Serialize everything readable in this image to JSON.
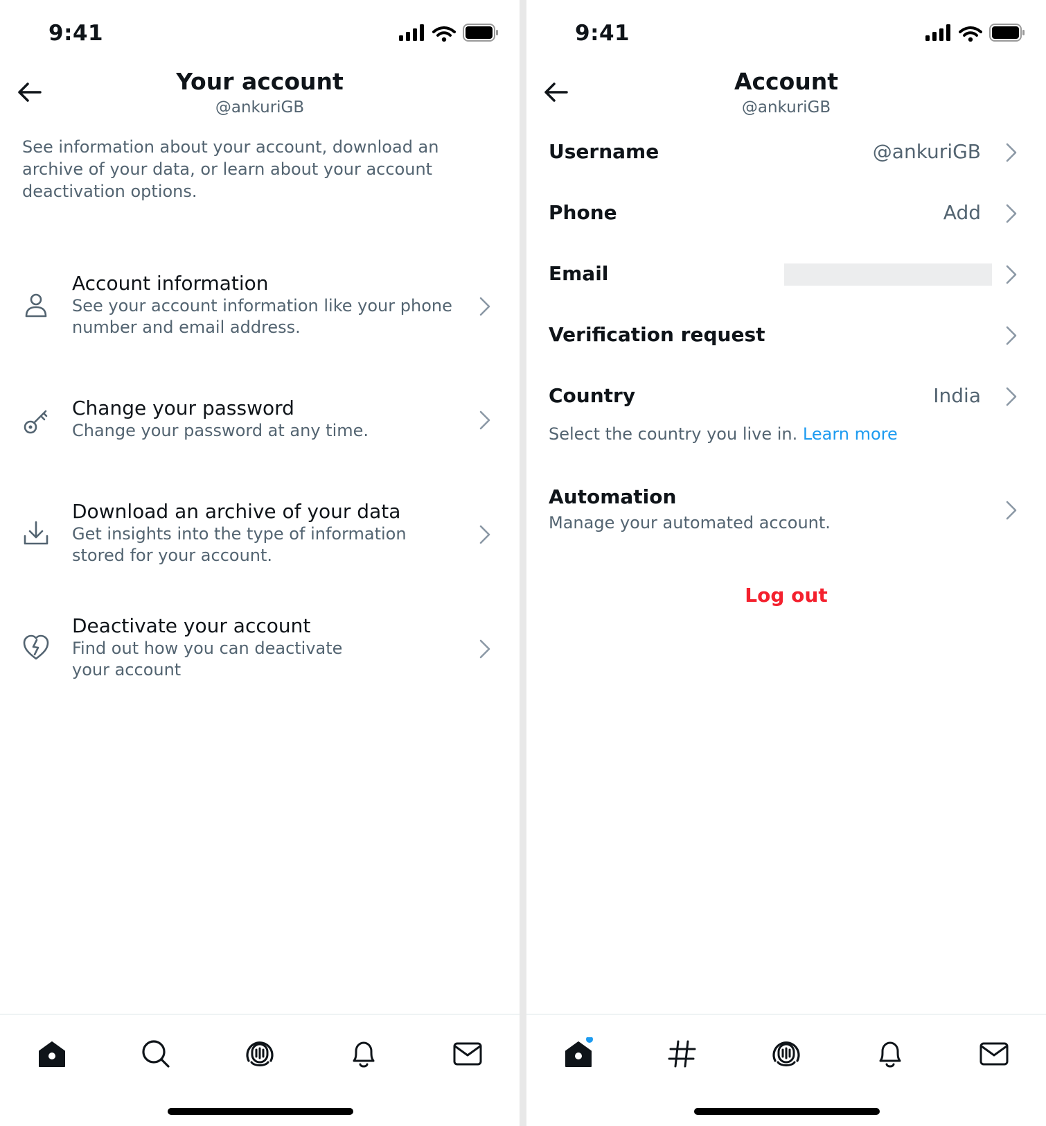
{
  "left": {
    "status": {
      "time": "9:41"
    },
    "header": {
      "title": "Your account",
      "handle": "@ankuriGB"
    },
    "intro": "See information about your account, download an archive of your data, or learn about your account deactivation options.",
    "items": [
      {
        "title": "Account information",
        "description": "See your account information like your phone number and email address.",
        "icon": "person-icon"
      },
      {
        "title": "Change your password",
        "description": "Change your password at any time.",
        "icon": "key-icon"
      },
      {
        "title": "Download an archive of your data",
        "description": "Get insights into the type of information stored for your account.",
        "icon": "download-icon"
      },
      {
        "title": "Deactivate your account",
        "description": "Find out how you can deactivate your account",
        "icon": "broken-heart-icon"
      }
    ],
    "tabs": [
      "home-icon",
      "search-icon",
      "spaces-icon",
      "notifications-icon",
      "messages-icon"
    ]
  },
  "right": {
    "status": {
      "time": "9:41"
    },
    "header": {
      "title": "Account",
      "handle": "@ankuriGB"
    },
    "rows": [
      {
        "label": "Username",
        "value": "@ankuriGB"
      },
      {
        "label": "Phone",
        "value": "Add"
      },
      {
        "label": "Email",
        "value": ""
      },
      {
        "label": "Verification request",
        "value": ""
      },
      {
        "label": "Country",
        "value": "India"
      }
    ],
    "country_help": {
      "text": "Select the country you live in. ",
      "link": "Learn more"
    },
    "automation": {
      "title": "Automation",
      "description": "Manage your automated account."
    },
    "logout": "Log out",
    "tabs": [
      "home-icon",
      "hashtag-icon",
      "spaces-icon",
      "notifications-icon",
      "messages-icon"
    ]
  },
  "colors": {
    "accent": "#1d9bf0",
    "danger": "#f4212e",
    "secondary_text": "#536471",
    "primary_text": "#0f1419"
  }
}
